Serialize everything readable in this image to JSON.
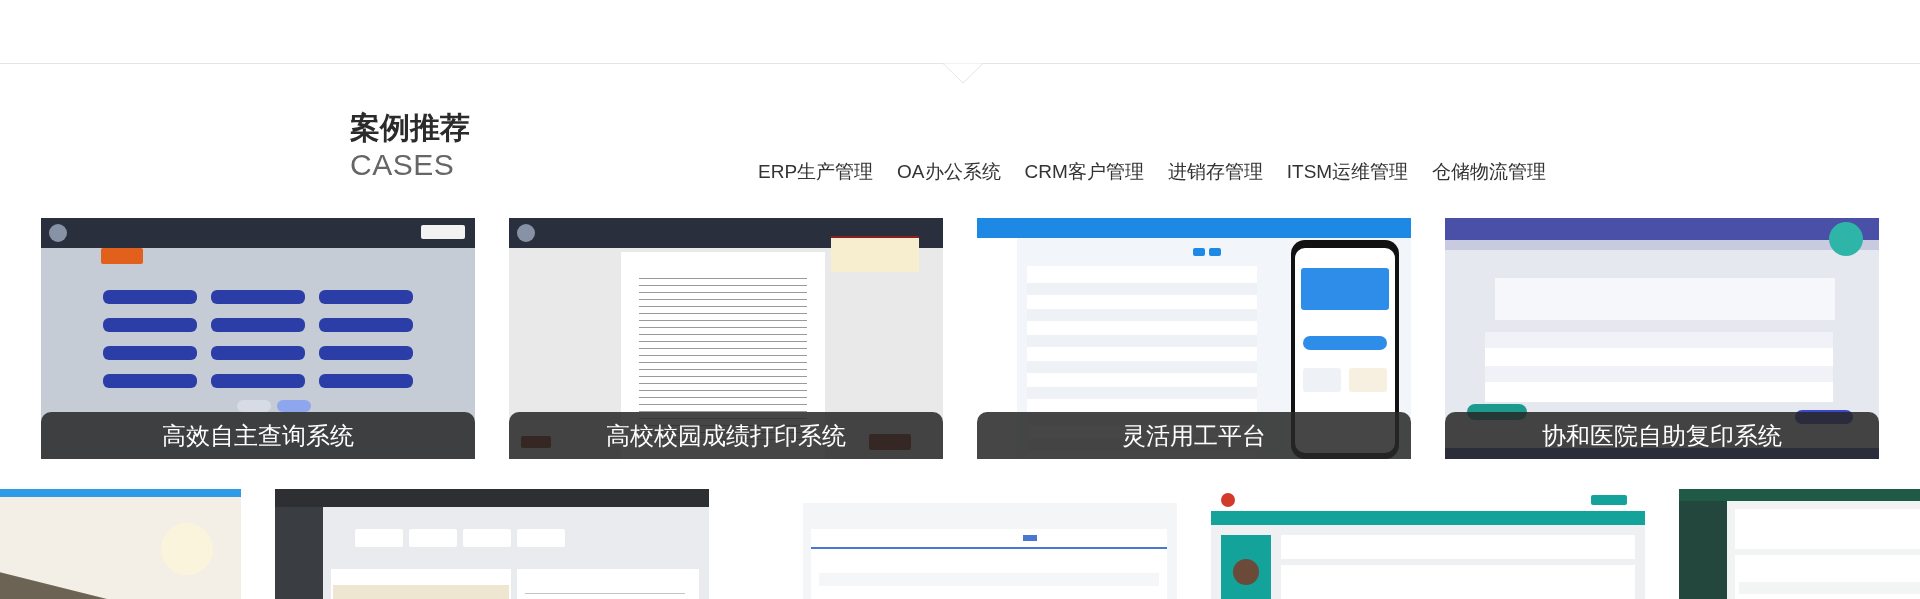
{
  "section": {
    "title": "案例推荐",
    "subtitle": "CASES"
  },
  "categories": [
    {
      "label": "ERP生产管理",
      "selected": false
    },
    {
      "label": "OA办公系统",
      "selected": false
    },
    {
      "label": "CRM客户管理",
      "selected": false
    },
    {
      "label": "进销存管理",
      "selected": false
    },
    {
      "label": "ITSM运维管理",
      "selected": false
    },
    {
      "label": "仓储物流管理",
      "selected": false
    }
  ],
  "case_rows": [
    [
      {
        "kind": "kiosk",
        "caption": "高效自主查询系统"
      },
      {
        "kind": "document",
        "caption": "高校校园成绩打印系统"
      },
      {
        "kind": "admin-phone",
        "caption": "灵活用工平台"
      },
      {
        "kind": "hospital",
        "caption": "协和医院自助复印系统"
      }
    ],
    [
      {
        "kind": "picture"
      },
      {
        "kind": "map-dashboard"
      },
      {
        "kind": "table"
      },
      {
        "kind": "teal-admin"
      },
      {
        "kind": "green-table"
      }
    ]
  ]
}
